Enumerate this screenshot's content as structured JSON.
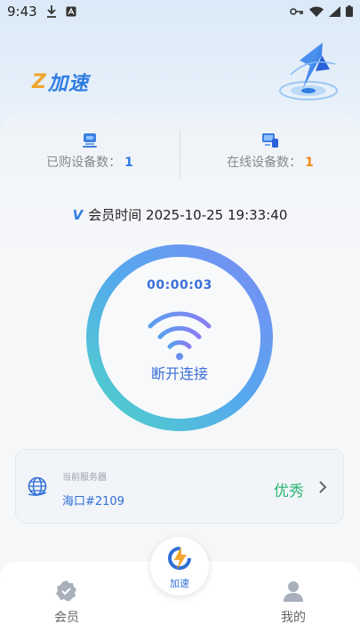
{
  "status_bar": {
    "time": "9:43"
  },
  "app": {
    "logo_mark": "Z",
    "logo_text": "加速"
  },
  "stats": {
    "purchased_label": "已购设备数：",
    "purchased_value": "1",
    "online_label": "在线设备数：",
    "online_value": "1"
  },
  "membership": {
    "badge": "V",
    "label": "会员时间",
    "expiry": "2025-10-25 19:33:40"
  },
  "connection": {
    "timer": "00:00:03",
    "action_label": "断开连接"
  },
  "server": {
    "label": "当前服务器",
    "name": "海口#2109",
    "quality": "优秀"
  },
  "tabbar": {
    "member": "会员",
    "boost": "加速",
    "mine": "我的"
  },
  "colors": {
    "accent": "#2f7de1",
    "orange": "#f08a1c",
    "green": "#2bb673"
  }
}
